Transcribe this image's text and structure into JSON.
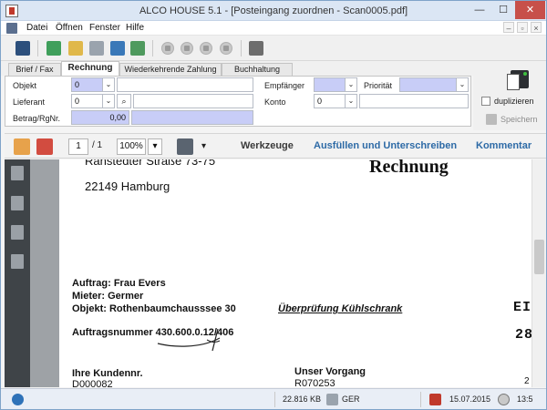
{
  "window": {
    "title": "ALCO HOUSE 5.1 - [Posteingang zuordnen - Scan0005.pdf]",
    "min": "—",
    "max": "☐",
    "close": "✕"
  },
  "menu": {
    "items": [
      "Datei",
      "Öffnen",
      "Fenster",
      "Hilfe"
    ],
    "mdi": [
      "–",
      "▫",
      "×"
    ]
  },
  "tabs": [
    "Brief / Fax",
    "Rechnung",
    "Wiederkehrende Zahlung",
    "Buchhaltung"
  ],
  "form": {
    "objekt_label": "Objekt",
    "objekt_value": "0",
    "lieferant_label": "Lieferant",
    "lieferant_value": "0",
    "betrag_label": "Betrag/RgNr.",
    "betrag_value": "0,00",
    "empfaenger_label": "Empfänger",
    "konto_label": "Konto",
    "konto_value": "0",
    "prioritaet_label": "Priorität"
  },
  "right_panel": {
    "duplizieren_label": "duplizieren",
    "speichern_label": "Speichern"
  },
  "pdf_toolbar": {
    "page_current": "1",
    "page_total": "/ 1",
    "zoom": "100%",
    "werkzeuge": "Werkzeuge",
    "ausfuellen": "Ausfüllen und Unterschreiben",
    "kommentar": "Kommentar"
  },
  "document": {
    "street": "Ranstedter Straße 73-75",
    "city": "22149   Hamburg",
    "heading": "Rechnung",
    "auftrag": "Auftrag: Frau Evers",
    "mieter": "Mieter: Germer",
    "objekt": "Objekt: Rothenbaumchausssee 30",
    "pruefung": "Überprüfung Kühlschrank",
    "ein": "EIN",
    "num28": "28",
    "auftragsnummer": "Auftragsnummer 430.600.0.12/406",
    "kundennr_label": "Ihre Kundennr.",
    "kundennr": "D000082",
    "vorgang_label": "Unser Vorgang",
    "vorgang": "R070253",
    "right_small": "2"
  },
  "status": {
    "size": "22.816 KB",
    "lang": "GER",
    "date": "15.07.2015",
    "time": "13:5"
  },
  "colors": {
    "field_blue": "#c8cdf7",
    "link_blue": "#2d6aa6",
    "close_red": "#c7504a",
    "sidebar_dark": "#3f4448"
  }
}
